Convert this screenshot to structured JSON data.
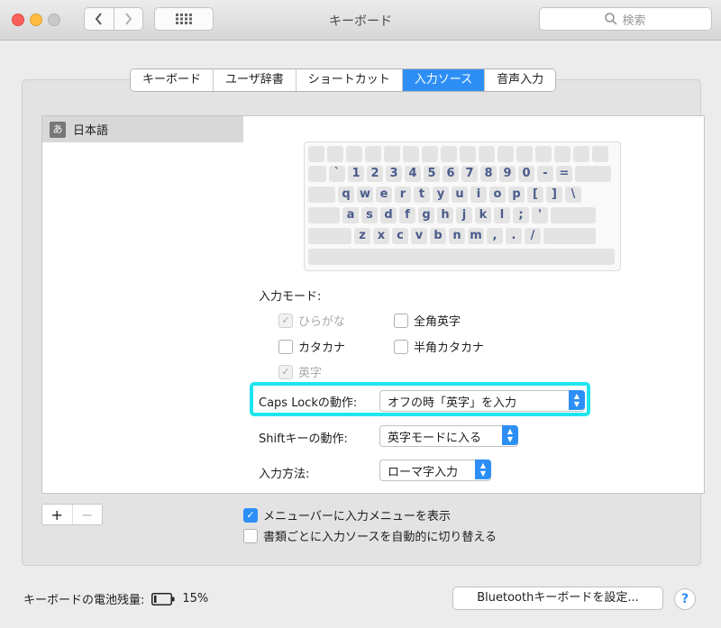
{
  "window": {
    "title": "キーボード"
  },
  "search": {
    "placeholder": "検索"
  },
  "tabs": [
    {
      "label": "キーボード",
      "active": false
    },
    {
      "label": "ユーザ辞書",
      "active": false
    },
    {
      "label": "ショートカット",
      "active": false
    },
    {
      "label": "入力ソース",
      "active": true
    },
    {
      "label": "音声入力",
      "active": false
    }
  ],
  "sources": {
    "items": [
      {
        "icon_text": "あ",
        "label": "日本語"
      }
    ]
  },
  "keyboard": {
    "rows": [
      [
        "`",
        "1",
        "2",
        "3",
        "4",
        "5",
        "6",
        "7",
        "8",
        "9",
        "0",
        "-",
        "="
      ],
      [
        "q",
        "w",
        "e",
        "r",
        "t",
        "y",
        "u",
        "i",
        "o",
        "p",
        "[",
        "]",
        "\\"
      ],
      [
        "a",
        "s",
        "d",
        "f",
        "g",
        "h",
        "j",
        "k",
        "l",
        ";",
        "'"
      ],
      [
        "z",
        "x",
        "c",
        "v",
        "b",
        "n",
        "m",
        ",",
        ".",
        "/"
      ]
    ]
  },
  "input_mode": {
    "label": "入力モード:",
    "options": [
      {
        "label": "ひらがな",
        "checked": true,
        "disabled": true
      },
      {
        "label": "全角英字",
        "checked": false,
        "disabled": false
      },
      {
        "label": "カタカナ",
        "checked": false,
        "disabled": false
      },
      {
        "label": "半角カタカナ",
        "checked": false,
        "disabled": false
      },
      {
        "label": "英字",
        "checked": true,
        "disabled": true
      }
    ]
  },
  "caps_lock": {
    "label": "Caps Lockの動作:",
    "value": "オフの時「英字」を入力"
  },
  "shift": {
    "label": "Shiftキーの動作:",
    "value": "英字モードに入る"
  },
  "method": {
    "label": "入力方法:",
    "value": "ローマ字入力"
  },
  "options": {
    "show_menu": {
      "label": "メニューバーに入力メニューを表示",
      "checked": true
    },
    "auto_switch": {
      "label": "書類ごとに入力ソースを自動的に切り替える",
      "checked": false
    }
  },
  "list_buttons": {
    "add": "+",
    "remove": "−"
  },
  "footer": {
    "battery_label": "キーボードの電池残量:",
    "battery_percent": "15%",
    "battery_level": 0.15,
    "bluetooth_button": "Bluetoothキーボードを設定...",
    "help": "?"
  },
  "colors": {
    "accent": "#2d8ff6",
    "highlight": "#1ee6ee",
    "key_text": "#4a5b8c"
  }
}
